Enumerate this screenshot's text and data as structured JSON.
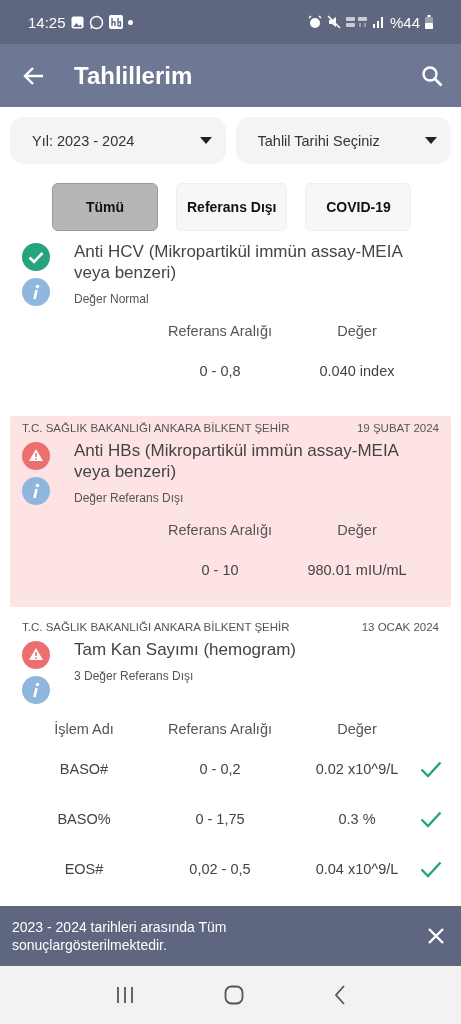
{
  "status_bar": {
    "time": "14:25",
    "battery": "%44"
  },
  "app_bar": {
    "title": "Tahlillerim"
  },
  "filters": [
    {
      "label": "Yıl: 2023 - 2024"
    },
    {
      "label": "Tahlil Tarihi Seçiniz"
    }
  ],
  "chips": [
    {
      "label": "Tümü",
      "selected": true
    },
    {
      "label": "Referans Dışı",
      "selected": false
    },
    {
      "label": "COVID-19",
      "selected": false
    }
  ],
  "results": [
    {
      "out_of_range": false,
      "highlighted": false,
      "name": "Anti HCV (Mikropartikül immün assay-MEIA veya benzeri)",
      "summary": "Değer Normal",
      "columns": [
        "Referans Aralığı",
        "Değer"
      ],
      "rows": [
        {
          "cells": [
            "0 - 0,8",
            "0.040 index"
          ]
        }
      ]
    },
    {
      "source": "T.C. SAĞLIK BAKANLIĞI ANKARA BİLKENT ŞEHİR",
      "date": "19 ŞUBAT 2024",
      "out_of_range": true,
      "highlighted": true,
      "name": "Anti HBs  (Mikropartikül immün assay-MEIA veya benzeri)",
      "summary": "Değer Referans Dışı",
      "columns": [
        "Referans Aralığı",
        "Değer"
      ],
      "rows": [
        {
          "cells": [
            "0 - 10",
            "980.01 mIU/mL"
          ]
        }
      ]
    },
    {
      "source": "T.C. SAĞLIK BAKANLIĞI ANKARA BİLKENT ŞEHİR",
      "date": "13 OCAK 2024",
      "out_of_range": true,
      "highlighted": false,
      "name": "Tam Kan Sayımı (hemogram)",
      "summary": "3 Değer Referans Dışı",
      "columns": [
        "İşlem Adı",
        "Referans Aralığı",
        "Değer"
      ],
      "rows": [
        {
          "cells": [
            "BASO#",
            "0 - 0,2",
            "0.02 x10^9/L"
          ],
          "in_range": true
        },
        {
          "cells": [
            "BASO%",
            "0 - 1,75",
            "0.3 %"
          ],
          "in_range": true
        },
        {
          "cells": [
            "EOS#",
            "0,02 - 0,5",
            "0.04 x10^9/L"
          ],
          "in_range": true
        }
      ]
    }
  ],
  "snackbar": {
    "message": "2023 - 2024 tarihleri arasında Tüm sonuçlargösterilmektedir."
  }
}
